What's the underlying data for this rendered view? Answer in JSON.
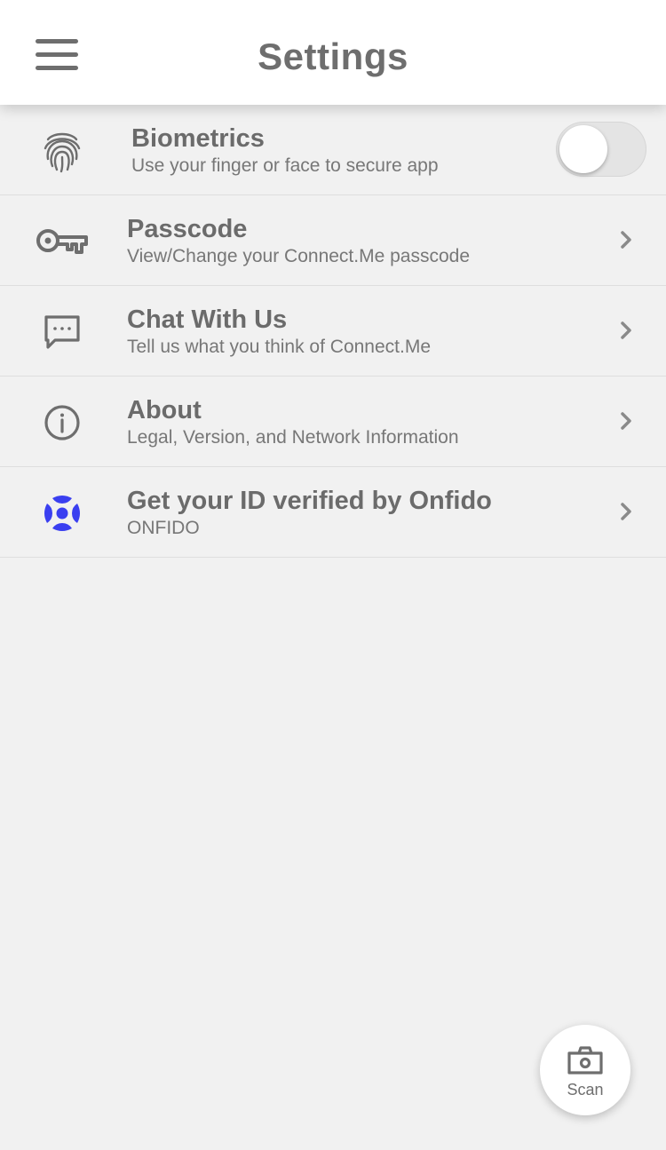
{
  "header": {
    "title": "Settings",
    "menu_icon": "hamburger-menu-icon"
  },
  "settings": [
    {
      "title": "Biometrics",
      "subtitle": "Use your finger or face to secure app",
      "icon": "fingerprint-icon",
      "control": "toggle",
      "toggle_on": false
    },
    {
      "title": "Passcode",
      "subtitle": "View/Change your Connect.Me passcode",
      "icon": "key-icon",
      "control": "chevron"
    },
    {
      "title": "Chat With Us",
      "subtitle": "Tell us what you think of Connect.Me",
      "icon": "chat-icon",
      "control": "chevron"
    },
    {
      "title": "About",
      "subtitle": "Legal, Version, and Network Information",
      "icon": "info-icon",
      "control": "chevron"
    },
    {
      "title": "Get your ID verified by Onfido",
      "subtitle": "ONFIDO",
      "icon": "onfido-logo-icon",
      "control": "chevron"
    }
  ],
  "scan": {
    "label": "Scan",
    "icon": "camera-icon"
  },
  "colors": {
    "background": "#f1f1f1",
    "header_bg": "#ffffff",
    "text_primary": "#6b6b6b",
    "text_secondary": "#777777",
    "onfido_blue": "#3a3ff0"
  }
}
